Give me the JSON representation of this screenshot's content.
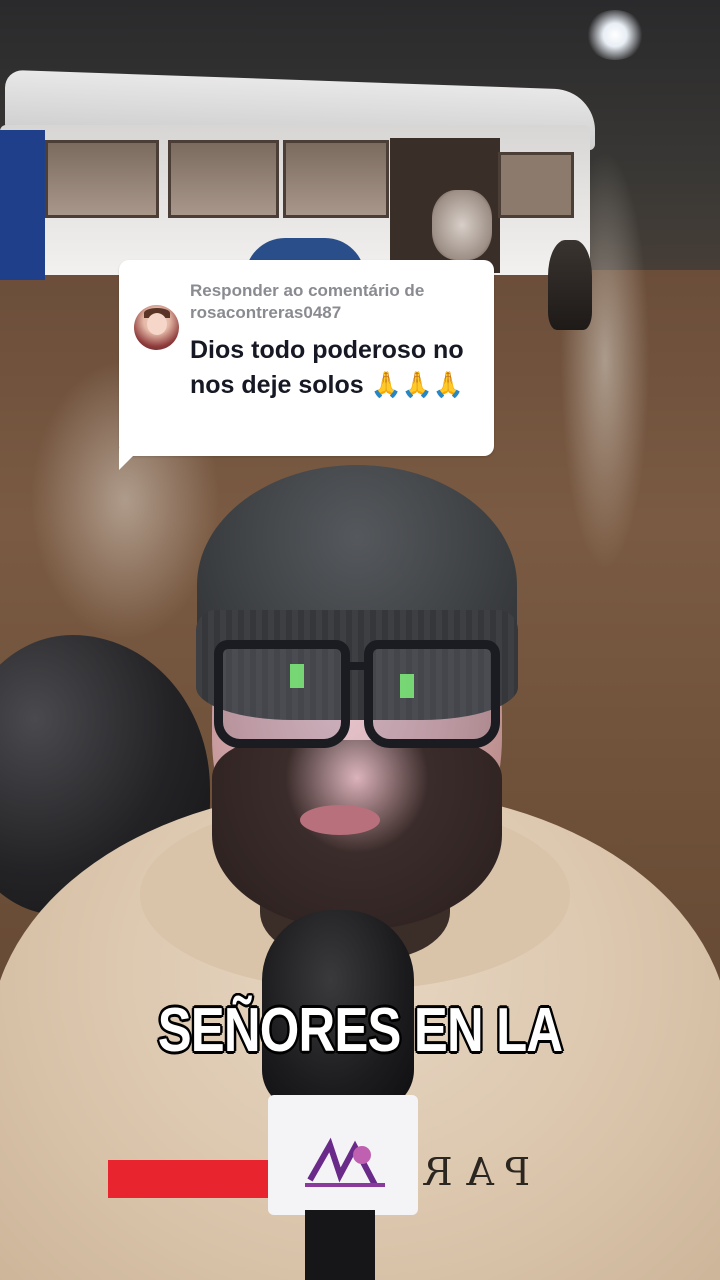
{
  "reply_card": {
    "label": "Responder ao comentário de rosacontreras0487",
    "comment": "Dios todo poderoso no nos deje solos 🙏🙏🙏"
  },
  "caption": "SEÑORES EN LA",
  "hoodie_print": "PAR",
  "icons": {
    "commenter_avatar": "user-avatar-icon",
    "microphone": "microphone-icon"
  },
  "colors": {
    "card_background": "#ffffff",
    "label_text": "#8a8b91",
    "comment_text": "#161823",
    "caption_text": "#ffffff",
    "caption_outline": "#000000"
  }
}
